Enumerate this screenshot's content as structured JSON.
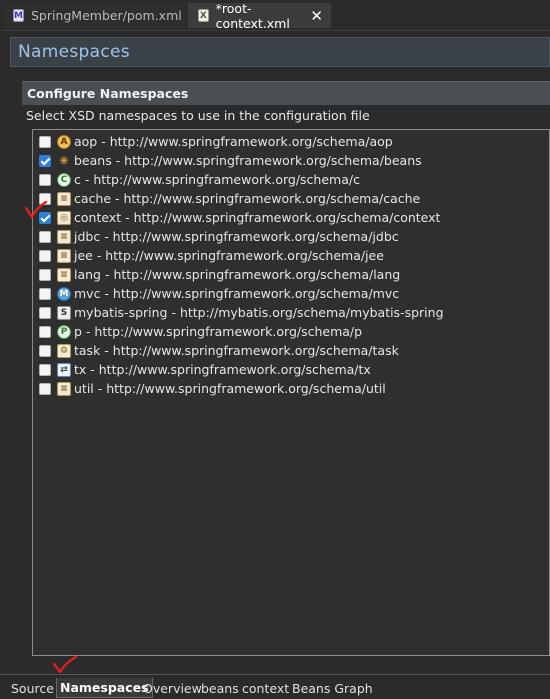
{
  "editor_tabs": [
    {
      "label": "SpringMember/pom.xml",
      "icon": "maven-pom-icon"
    },
    {
      "label": "*root-context.xml",
      "icon": "xml-file-icon",
      "close": "✕"
    }
  ],
  "header": {
    "title": "Namespaces"
  },
  "section": {
    "title": "Configure Namespaces",
    "description": "Select XSD namespaces to use in the configuration file"
  },
  "namespaces": [
    {
      "label": "aop - http://www.springframework.org/schema/aop",
      "checked": false,
      "icon": "aop-icon"
    },
    {
      "label": "beans - http://www.springframework.org/schema/beans",
      "checked": true,
      "icon": "beans-icon"
    },
    {
      "label": "c - http://www.springframework.org/schema/c",
      "checked": false,
      "icon": "c-namespace-icon"
    },
    {
      "label": "cache - http://www.springframework.org/schema/cache",
      "checked": false,
      "icon": "cache-icon"
    },
    {
      "label": "context - http://www.springframework.org/schema/context",
      "checked": true,
      "icon": "context-icon"
    },
    {
      "label": "jdbc - http://www.springframework.org/schema/jdbc",
      "checked": false,
      "icon": "jdbc-icon"
    },
    {
      "label": "jee - http://www.springframework.org/schema/jee",
      "checked": false,
      "icon": "jee-icon"
    },
    {
      "label": "lang - http://www.springframework.org/schema/lang",
      "checked": false,
      "icon": "lang-icon"
    },
    {
      "label": "mvc - http://www.springframework.org/schema/mvc",
      "checked": false,
      "icon": "mvc-icon"
    },
    {
      "label": "mybatis-spring - http://mybatis.org/schema/mybatis-spring",
      "checked": false,
      "icon": "mybatis-icon"
    },
    {
      "label": "p - http://www.springframework.org/schema/p",
      "checked": false,
      "icon": "p-namespace-icon"
    },
    {
      "label": "task - http://www.springframework.org/schema/task",
      "checked": false,
      "icon": "task-icon"
    },
    {
      "label": "tx - http://www.springframework.org/schema/tx",
      "checked": false,
      "icon": "tx-icon"
    },
    {
      "label": "util - http://www.springframework.org/schema/util",
      "checked": false,
      "icon": "util-icon"
    }
  ],
  "page_tabs": [
    {
      "label": "Source",
      "active": false
    },
    {
      "label": "Namespaces",
      "active": true
    },
    {
      "label": "Overview",
      "active": false
    },
    {
      "label": "beans",
      "active": false
    },
    {
      "label": "context",
      "active": false
    },
    {
      "label": "Beans Graph",
      "active": false
    }
  ],
  "colors": {
    "background": "#2b2b2b",
    "header_title": "#9ec3e6",
    "checkbox_checked": "#2f7fd6",
    "annotation": "#e02020"
  }
}
